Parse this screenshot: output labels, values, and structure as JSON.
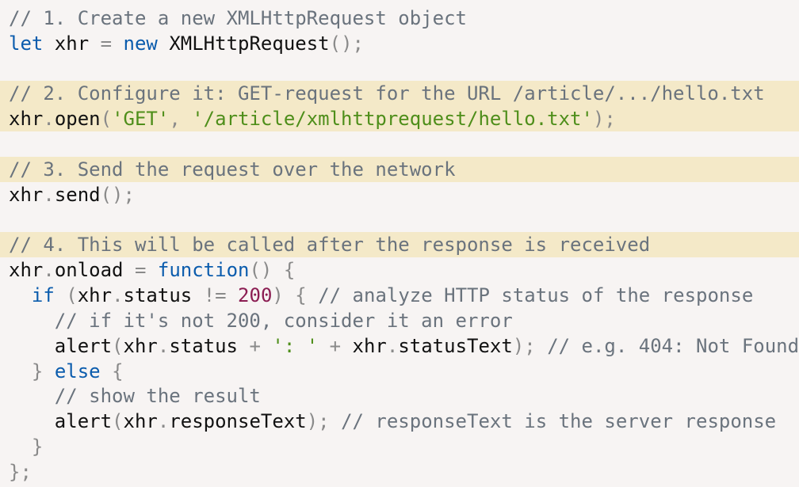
{
  "code_block": {
    "language": "javascript",
    "colors": {
      "background": "#f7f4f3",
      "highlight": "#f4e9c8",
      "comment": "#6a737d",
      "keyword": "#0b5cad",
      "string": "#4e8e1a",
      "number": "#8b1d52",
      "punctuation": "#8a8a8a",
      "identifier": "#111111"
    },
    "lines": [
      {
        "highlight": false,
        "tokens": [
          {
            "t": "com",
            "v": "// 1. Create a new XMLHttpRequest object"
          }
        ]
      },
      {
        "highlight": false,
        "tokens": [
          {
            "t": "kw",
            "v": "let"
          },
          {
            "t": "id",
            "v": " xhr "
          },
          {
            "t": "pun",
            "v": "="
          },
          {
            "t": "id",
            "v": " "
          },
          {
            "t": "kw",
            "v": "new"
          },
          {
            "t": "id",
            "v": " XMLHttpRequest"
          },
          {
            "t": "pun",
            "v": "();"
          }
        ]
      },
      {
        "highlight": false,
        "tokens": []
      },
      {
        "highlight": true,
        "tokens": [
          {
            "t": "com",
            "v": "// 2. Configure it: GET-request for the URL /article/.../hello.txt"
          }
        ]
      },
      {
        "highlight": true,
        "tokens": [
          {
            "t": "id",
            "v": "xhr"
          },
          {
            "t": "pun",
            "v": "."
          },
          {
            "t": "id",
            "v": "open"
          },
          {
            "t": "pun",
            "v": "("
          },
          {
            "t": "str",
            "v": "'GET'"
          },
          {
            "t": "pun",
            "v": ", "
          },
          {
            "t": "str",
            "v": "'/article/xmlhttprequest/hello.txt'"
          },
          {
            "t": "pun",
            "v": ");"
          }
        ]
      },
      {
        "highlight": false,
        "tokens": []
      },
      {
        "highlight": true,
        "tokens": [
          {
            "t": "com",
            "v": "// 3. Send the request over the network"
          }
        ]
      },
      {
        "highlight": false,
        "tokens": [
          {
            "t": "id",
            "v": "xhr"
          },
          {
            "t": "pun",
            "v": "."
          },
          {
            "t": "id",
            "v": "send"
          },
          {
            "t": "pun",
            "v": "();"
          }
        ]
      },
      {
        "highlight": false,
        "tokens": []
      },
      {
        "highlight": true,
        "tokens": [
          {
            "t": "com",
            "v": "// 4. This will be called after the response is received"
          }
        ]
      },
      {
        "highlight": false,
        "tokens": [
          {
            "t": "id",
            "v": "xhr"
          },
          {
            "t": "pun",
            "v": "."
          },
          {
            "t": "id",
            "v": "onload "
          },
          {
            "t": "pun",
            "v": "="
          },
          {
            "t": "id",
            "v": " "
          },
          {
            "t": "kw",
            "v": "function"
          },
          {
            "t": "pun",
            "v": "() {"
          }
        ]
      },
      {
        "highlight": false,
        "tokens": [
          {
            "t": "id",
            "v": "  "
          },
          {
            "t": "kw",
            "v": "if"
          },
          {
            "t": "id",
            "v": " "
          },
          {
            "t": "pun",
            "v": "("
          },
          {
            "t": "id",
            "v": "xhr"
          },
          {
            "t": "pun",
            "v": "."
          },
          {
            "t": "id",
            "v": "status "
          },
          {
            "t": "pun",
            "v": "!="
          },
          {
            "t": "id",
            "v": " "
          },
          {
            "t": "num",
            "v": "200"
          },
          {
            "t": "pun",
            "v": ") { "
          },
          {
            "t": "com",
            "v": "// analyze HTTP status of the response"
          }
        ]
      },
      {
        "highlight": false,
        "tokens": [
          {
            "t": "id",
            "v": "    "
          },
          {
            "t": "com",
            "v": "// if it's not 200, consider it an error"
          }
        ]
      },
      {
        "highlight": false,
        "tokens": [
          {
            "t": "id",
            "v": "    alert"
          },
          {
            "t": "pun",
            "v": "("
          },
          {
            "t": "id",
            "v": "xhr"
          },
          {
            "t": "pun",
            "v": "."
          },
          {
            "t": "id",
            "v": "status "
          },
          {
            "t": "pun",
            "v": "+"
          },
          {
            "t": "id",
            "v": " "
          },
          {
            "t": "str",
            "v": "': '"
          },
          {
            "t": "id",
            "v": " "
          },
          {
            "t": "pun",
            "v": "+"
          },
          {
            "t": "id",
            "v": " xhr"
          },
          {
            "t": "pun",
            "v": "."
          },
          {
            "t": "id",
            "v": "statusText"
          },
          {
            "t": "pun",
            "v": "); "
          },
          {
            "t": "com",
            "v": "// e.g. 404: Not Found"
          }
        ]
      },
      {
        "highlight": false,
        "tokens": [
          {
            "t": "id",
            "v": "  "
          },
          {
            "t": "pun",
            "v": "} "
          },
          {
            "t": "kw",
            "v": "else"
          },
          {
            "t": "id",
            "v": " "
          },
          {
            "t": "pun",
            "v": "{"
          }
        ]
      },
      {
        "highlight": false,
        "tokens": [
          {
            "t": "id",
            "v": "    "
          },
          {
            "t": "com",
            "v": "// show the result"
          }
        ]
      },
      {
        "highlight": false,
        "tokens": [
          {
            "t": "id",
            "v": "    alert"
          },
          {
            "t": "pun",
            "v": "("
          },
          {
            "t": "id",
            "v": "xhr"
          },
          {
            "t": "pun",
            "v": "."
          },
          {
            "t": "id",
            "v": "responseText"
          },
          {
            "t": "pun",
            "v": "); "
          },
          {
            "t": "com",
            "v": "// responseText is the server response"
          }
        ]
      },
      {
        "highlight": false,
        "tokens": [
          {
            "t": "id",
            "v": "  "
          },
          {
            "t": "pun",
            "v": "}"
          }
        ]
      },
      {
        "highlight": false,
        "tokens": [
          {
            "t": "pun",
            "v": "};"
          }
        ]
      }
    ]
  }
}
